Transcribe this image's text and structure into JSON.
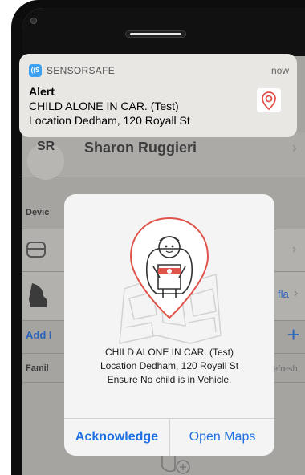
{
  "notification": {
    "app_name": "SENSORSAFE",
    "app_icon_text": "((S",
    "time": "now",
    "title": "Alert",
    "line1": "CHILD ALONE IN CAR. (Test)",
    "line2": "Location Dedham, 120 Royall St",
    "icon": "map-pin-icon"
  },
  "profile": {
    "initials": "SR",
    "name": "Sharon Ruggieri"
  },
  "background": {
    "devices_header": "Devic",
    "add_label": "Add I",
    "car_seat_label": "fla",
    "family_header": "Famil",
    "refresh_label": "efresh"
  },
  "alert_dialog": {
    "message_line1": "CHILD ALONE IN CAR. (Test)",
    "message_line2": "Location Dedham, 120 Royall St",
    "message_line3": "Ensure No child is in Vehicle.",
    "acknowledge_label": "Acknowledge",
    "open_maps_label": "Open Maps"
  },
  "colors": {
    "accent_blue": "#1e6fe0",
    "pin_red": "#e0534a",
    "notif_bg": "#e8e7e4"
  }
}
